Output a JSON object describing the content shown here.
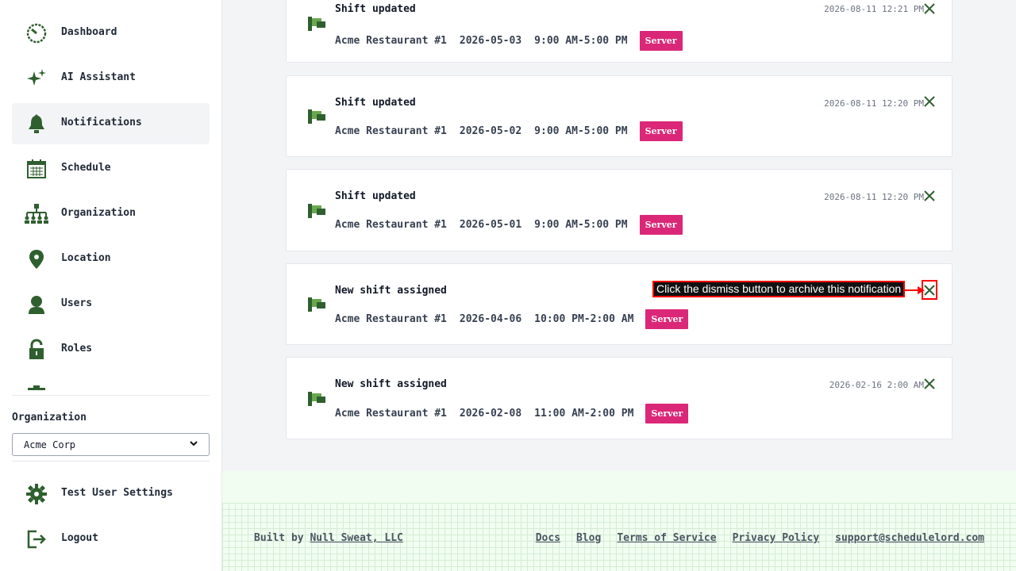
{
  "sidebar": {
    "items": [
      {
        "label": "Dashboard",
        "icon": "dashboard-icon"
      },
      {
        "label": "AI Assistant",
        "icon": "sparkle-icon"
      },
      {
        "label": "Notifications",
        "icon": "bell-icon",
        "active": true
      },
      {
        "label": "Schedule",
        "icon": "calendar-icon"
      },
      {
        "label": "Organization",
        "icon": "org-chart-icon"
      },
      {
        "label": "Location",
        "icon": "location-pin-icon"
      },
      {
        "label": "Users",
        "icon": "user-icon"
      },
      {
        "label": "Roles",
        "icon": "lock-icon"
      }
    ],
    "organization_label": "Organization",
    "organization_value": "Acme Corp",
    "bottom_items": [
      {
        "label": "Test User Settings",
        "icon": "gear-icon"
      },
      {
        "label": "Logout",
        "icon": "logout-icon"
      }
    ]
  },
  "notifications": [
    {
      "title": "Shift updated",
      "location": "Acme Restaurant #1",
      "date": "2026-05-03",
      "time_range": "9:00 AM-5:00 PM",
      "role": "Server",
      "timestamp": "2026-08-11 12:21 PM"
    },
    {
      "title": "Shift updated",
      "location": "Acme Restaurant #1",
      "date": "2026-05-02",
      "time_range": "9:00 AM-5:00 PM",
      "role": "Server",
      "timestamp": "2026-08-11 12:20 PM"
    },
    {
      "title": "Shift updated",
      "location": "Acme Restaurant #1",
      "date": "2026-05-01",
      "time_range": "9:00 AM-5:00 PM",
      "role": "Server",
      "timestamp": "2026-08-11 12:20 PM"
    },
    {
      "title": "New shift assigned",
      "location": "Acme Restaurant #1",
      "date": "2026-04-06",
      "time_range": "10:00 PM-2:00 AM",
      "role": "Server",
      "timestamp": ""
    },
    {
      "title": "New shift assigned",
      "location": "Acme Restaurant #1",
      "date": "2026-02-08",
      "time_range": "11:00 AM-2:00 PM",
      "role": "Server",
      "timestamp": "2026-02-16 2:00 AM"
    }
  ],
  "annotation": {
    "text": "Click the dismiss button to archive this notification"
  },
  "footer": {
    "built_by_prefix": "Built by",
    "built_by_link": "Null Sweat, LLC",
    "links": [
      "Docs",
      "Blog",
      "Terms of Service",
      "Privacy Policy",
      "support@schedulelord.com"
    ]
  },
  "colors": {
    "accent_green": "#2f5f2f",
    "badge": "#db2777",
    "annotation_red": "#ff0000"
  }
}
